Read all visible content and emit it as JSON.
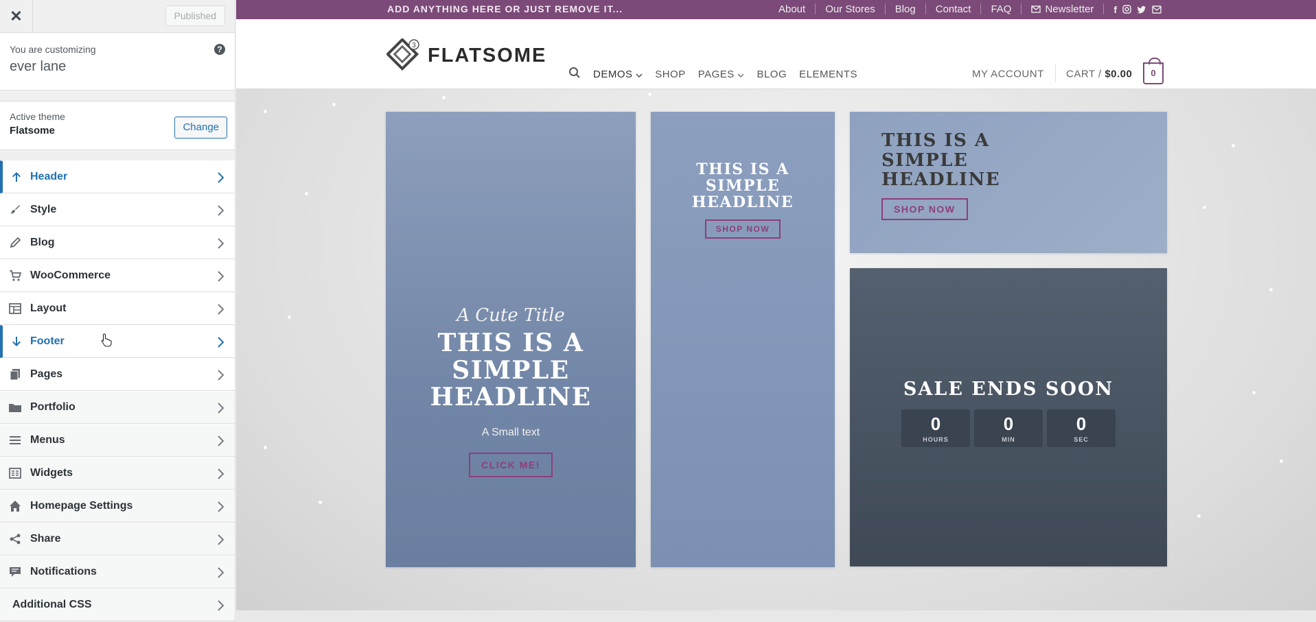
{
  "customizer": {
    "close_label": "✕",
    "published_label": "Published",
    "customizing_label": "You are customizing",
    "site_name": "ever lane",
    "help_label": "?",
    "active_theme_label": "Active theme",
    "theme_name": "Flatsome",
    "change_label": "Change",
    "panels": [
      {
        "label": "Header",
        "icon": "arrow-up-icon"
      },
      {
        "label": "Style",
        "icon": "brush-icon"
      },
      {
        "label": "Blog",
        "icon": "pencil-icon"
      },
      {
        "label": "WooCommerce",
        "icon": "cart-icon"
      },
      {
        "label": "Layout",
        "icon": "layout-icon"
      },
      {
        "label": "Footer",
        "icon": "arrow-down-icon"
      },
      {
        "label": "Pages",
        "icon": "pages-icon"
      },
      {
        "label": "Portfolio",
        "icon": "folder-icon"
      },
      {
        "label": "Menus",
        "icon": "menu-icon"
      },
      {
        "label": "Widgets",
        "icon": "widgets-icon"
      },
      {
        "label": "Homepage Settings",
        "icon": "home-icon"
      },
      {
        "label": "Share",
        "icon": "share-icon"
      },
      {
        "label": "Notifications",
        "icon": "comment-icon"
      },
      {
        "label": "Additional CSS",
        "icon": ""
      }
    ]
  },
  "site": {
    "topbar_message": "ADD ANYTHING HERE OR JUST REMOVE IT...",
    "topbar_links": [
      "About",
      "Our Stores",
      "Blog",
      "Contact",
      "FAQ"
    ],
    "newsletter_label": "Newsletter",
    "logo_text": "FLATSOME",
    "logo_badge": "3",
    "nav": {
      "demos": "DEMOS",
      "shop": "SHOP",
      "pages": "PAGES",
      "blog": "BLOG",
      "elements": "ELEMENTS"
    },
    "account_label": "MY ACCOUNT",
    "cart_label": "CART /",
    "cart_amount": "$0.00",
    "cart_count": "0",
    "accent_color": "#7b4a78"
  },
  "tiles": {
    "main": {
      "cute_title": "A Cute Title",
      "headline_lines": [
        "THIS IS A",
        "SIMPLE",
        "HEADLINE"
      ],
      "small_text": "A Small text",
      "button": "CLICK ME!"
    },
    "middle": {
      "headline_lines": [
        "THIS IS A",
        "SIMPLE",
        "HEADLINE"
      ],
      "button": "SHOP NOW"
    },
    "top_right": {
      "headline_lines": [
        "THIS IS A",
        "SIMPLE",
        "HEADLINE"
      ],
      "button": "SHOP NOW"
    },
    "sale": {
      "headline": "SALE ENDS SOON",
      "countdown": [
        {
          "value": "0",
          "unit": "HOURS"
        },
        {
          "value": "0",
          "unit": "MIN"
        },
        {
          "value": "0",
          "unit": "SEC"
        }
      ]
    }
  }
}
